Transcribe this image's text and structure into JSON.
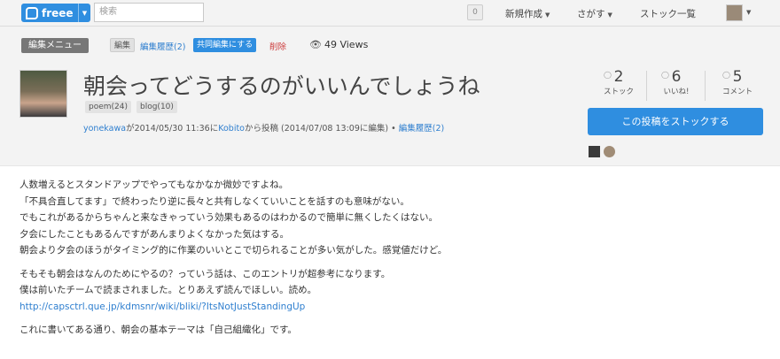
{
  "topbar": {
    "logo_text": "freee",
    "search_placeholder": "検索",
    "notification_count": "0",
    "nav_new_post": "新規作成",
    "nav_search": "さがす",
    "nav_stock_list": "ストック一覧"
  },
  "toolbar": {
    "edit_menu": "編集メニュー",
    "edit": "編集",
    "edit_history": "編集履歴(2)",
    "collab_edit": "共同編集にする",
    "delete": "削除",
    "views": "49 Views"
  },
  "post": {
    "title": "朝会ってどうするのがいいんでしょうね",
    "tags": [
      "poem(24)",
      "blog(10)"
    ],
    "meta": {
      "author": "yonekawa",
      "posted_text": "が2014/05/30 11:36に",
      "client": "Kobito",
      "posted_suffix": "から投稿 (2014/07/08 13:09に編集) • ",
      "history": "編集履歴(2)"
    },
    "stats": {
      "stock_count": "2",
      "stock_label": "ストック",
      "like_count": "6",
      "like_label": "いいね!",
      "comment_count": "5",
      "comment_label": "コメント"
    },
    "stock_button": "この投稿をストックする"
  },
  "body": {
    "paragraphs": [
      [
        "人数増えるとスタンドアップでやってもなかなか微妙ですよね。",
        "「不具合直してます」で終わったり逆に長々と共有しなくていいことを話すのも意味がない。",
        "でもこれがあるからちゃんと来なきゃっていう効果もあるのはわかるので簡単に無くしたくはない。",
        "夕会にしたこともあるんですがあんまりよくなかった気はする。",
        "朝会より夕会のほうがタイミング的に作業のいいとこで切られることが多い気がした。感覚値だけど。"
      ],
      [
        "そもそも朝会はなんのためにやるの？っていう話は、このエントリが超参考になります。",
        "僕は前いたチームで読まされました。とりあえず読んでほしい。読め。",
        "http://capsctrl.que.jp/kdmsnr/wiki/bliki/?ItsNotJustStandingUp"
      ],
      [
        "これに書いてある通り、朝会の基本テーマは「自己組織化」です。"
      ]
    ]
  },
  "colors": {
    "accent": "#2f8ee0",
    "link": "#2f7fcf",
    "danger": "#cc3a3a",
    "header_bg": "#f3f3f3"
  }
}
